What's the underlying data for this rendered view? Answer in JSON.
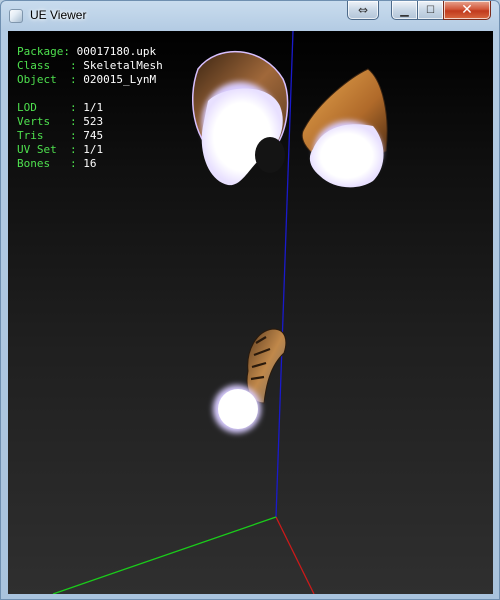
{
  "window": {
    "title": "UE Viewer",
    "controls": {
      "restore_alt_glyph": "⇔",
      "minimize_glyph": "▁",
      "maximize_glyph": "☐",
      "close_glyph": "✕"
    }
  },
  "info": {
    "package": {
      "label": "Package: ",
      "value": "00017180.upk"
    },
    "class": {
      "label": "Class   : ",
      "value": "SkeletalMesh"
    },
    "object": {
      "label": "Object  : ",
      "value": "020015_LynM"
    },
    "lod": {
      "label": "LOD     : ",
      "value": "1/1"
    },
    "verts": {
      "label": "Verts   : ",
      "value": "523"
    },
    "tris": {
      "label": "Tris    : ",
      "value": "745"
    },
    "uvset": {
      "label": "UV Set  : ",
      "value": "1/1"
    },
    "bones": {
      "label": "Bones   : ",
      "value": "16"
    }
  },
  "colors": {
    "label_green": "#4ee04e",
    "value_white": "#ffffff",
    "axis_x": "#d01010",
    "axis_y": "#1010c8",
    "axis_z": "#10c010"
  }
}
